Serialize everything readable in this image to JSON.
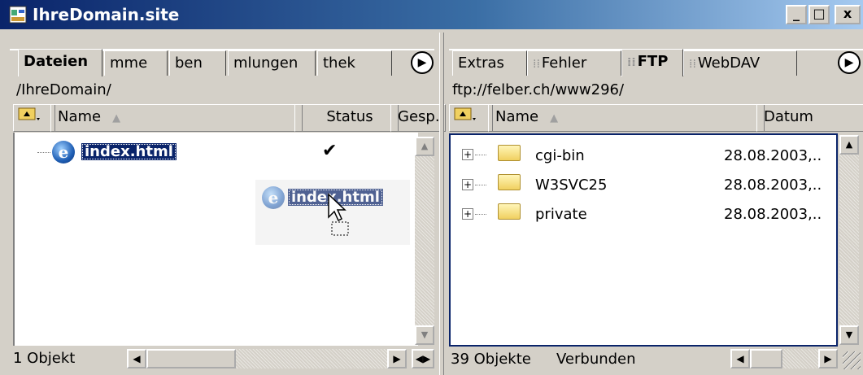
{
  "window": {
    "title": "IhreDomain.site",
    "minimize": "_",
    "maximize": "□",
    "close": "x"
  },
  "left": {
    "tabs": [
      "Dateien",
      "mme",
      "ben",
      "mlungen",
      "thek"
    ],
    "path": "/IhreDomain/",
    "columns": [
      "Name",
      "Status",
      "Gesp."
    ],
    "file": {
      "name": "index.html",
      "status": "✔"
    },
    "drag_label": "index.html",
    "status": "1 Objekt"
  },
  "right": {
    "tabs": [
      "Extras",
      "Fehler",
      "FTP",
      "WebDAV"
    ],
    "path": "ftp://felber.ch/www296/",
    "columns": [
      "Name",
      "Datum"
    ],
    "folders": [
      {
        "name": "cgi-bin",
        "date": "28.08.2003,.."
      },
      {
        "name": "W3SVC25",
        "date": "28.08.2003,.."
      },
      {
        "name": "private",
        "date": "28.08.2003,.."
      }
    ],
    "status_count": "39 Objekte",
    "status_state": "Verbunden"
  },
  "icons": [
    "site-icon",
    "ie-file-icon",
    "folder-icon",
    "check-icon",
    "expand-plus-icon",
    "tab-scroll-icon",
    "mouse-cursor-icon"
  ],
  "colors": {
    "titlebar": "#0a246a",
    "selection": "#0a246a",
    "face": "#d4d0c8"
  }
}
